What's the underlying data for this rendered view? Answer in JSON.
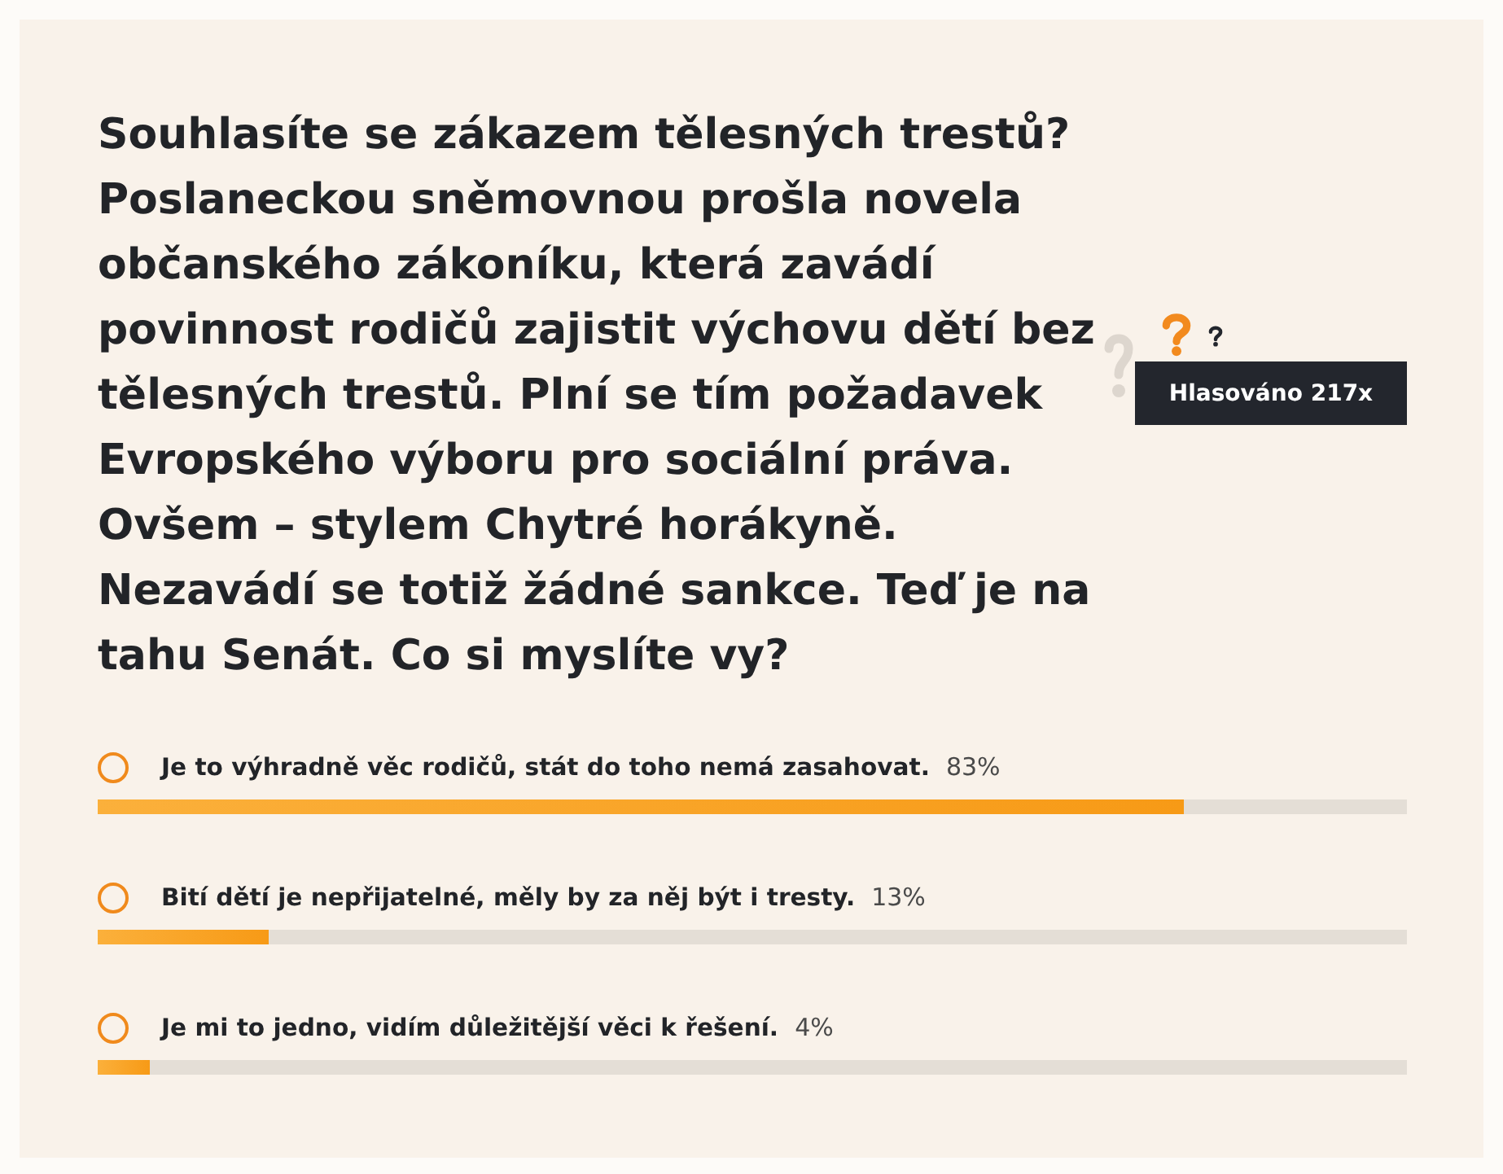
{
  "poll": {
    "question": "Souhlasíte se zákazem tělesných trestů? Poslaneckou sněmovnou prošla novela občanského zákoníku, která zavádí povinnost rodičů zajistit výchovu dětí bez tělesných trestů. Plní se tím požadavek Evropského výboru pro sociální práva. Ovšem – stylem Chytré horákyně. Nezavádí se totiž žádné sankce. Teď je na tahu Senát. Co si myslíte vy?",
    "votes_badge": "Hlasováno 217x",
    "options": [
      {
        "label": "Je to výhradně věc rodičů, stát do toho nemá zasahovat.",
        "percent": "83%",
        "level": 0.83,
        "selected": false
      },
      {
        "label": "Bití dětí je nepřijatelné, měly by za něj být i tresty.",
        "percent": "13%",
        "level": 0.13,
        "selected": false
      },
      {
        "label": "Je mi to jedno, vidím důležitější věci k řešení.",
        "percent": "4%",
        "level": 0.04,
        "selected": false
      }
    ]
  }
}
